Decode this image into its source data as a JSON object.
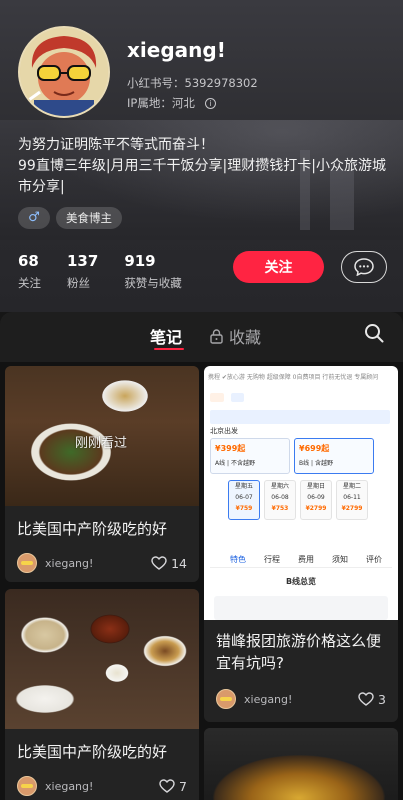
{
  "profile": {
    "username": "xiegang!",
    "redbook_id_label": "小红书号：5392978302",
    "ip_label": "IP属地：河北",
    "bio_line1": "为努力证明陈平不等式而奋斗！",
    "bio_line2": "99直博三年级|月用三千干饭分享|理财攒钱打卡|小众旅游城市分享|",
    "tags": {
      "gender": "♂",
      "category": "美食博主"
    },
    "stats": [
      {
        "value": "68",
        "label": "关注"
      },
      {
        "value": "137",
        "label": "粉丝"
      },
      {
        "value": "919",
        "label": "获赞与收藏"
      }
    ],
    "follow_label": "关注"
  },
  "tabs": {
    "notes": "笔记",
    "favorites": "收藏"
  },
  "feed": {
    "left": [
      {
        "overlay": "刚刚看过",
        "title": "比美国中产阶级吃的好",
        "author": "xiegang!",
        "likes": "14"
      },
      {
        "title": "比美国中产阶级吃的好",
        "author": "xiegang!",
        "likes": "7"
      }
    ],
    "right": [
      {
        "title": "错峰报团旅游价格这么便宜有坑吗?",
        "author": "xiegang!",
        "likes": "3",
        "shot": {
          "topline": "携程  ✔放心游  无购物  超级保障  0自费项目  行前无忧退  专属顾问",
          "depart": "北京出发",
          "options": [
            {
              "price": "¥399起",
              "name": "A线 | 不含越野"
            },
            {
              "price": "¥699起",
              "name": "B线 | 含越野"
            }
          ],
          "dates": [
            {
              "day": "星期五",
              "date": "06-07",
              "price": "¥759"
            },
            {
              "day": "星期六",
              "date": "06-08",
              "price": "¥753"
            },
            {
              "day": "星期日",
              "date": "06-09",
              "price": "¥2799"
            },
            {
              "day": "星期二",
              "date": "06-11",
              "price": "¥2799"
            }
          ],
          "tabs": [
            "特色",
            "行程",
            "费用",
            "须知",
            "评价"
          ],
          "subtitle": "B线总览"
        }
      }
    ]
  }
}
